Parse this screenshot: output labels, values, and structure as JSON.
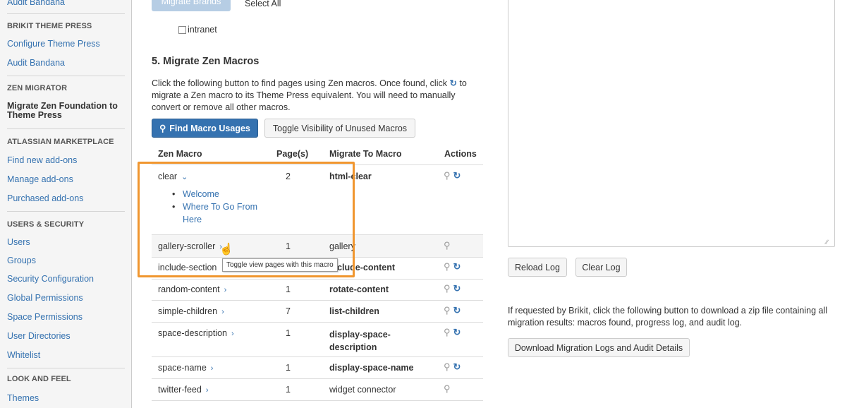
{
  "sidebar": {
    "items_top": [
      "Audit Bandana"
    ],
    "sections": [
      {
        "heading": "BRIKIT THEME PRESS",
        "items": [
          "Configure Theme Press",
          "Audit Bandana"
        ]
      },
      {
        "heading": "ZEN MIGRATOR",
        "active": "Migrate Zen Foundation to Theme Press"
      },
      {
        "heading": "ATLASSIAN MARKETPLACE",
        "items": [
          "Find new add-ons",
          "Manage add-ons",
          "Purchased add-ons"
        ]
      },
      {
        "heading": "USERS & SECURITY",
        "items": [
          "Users",
          "Groups",
          "Security Configuration",
          "Global Permissions",
          "Space Permissions",
          "User Directories",
          "Whitelist"
        ]
      },
      {
        "heading": "LOOK AND FEEL",
        "items": [
          "Themes"
        ]
      }
    ]
  },
  "brands": {
    "migrate_button": "Migrate Brands",
    "select_all": "Select All",
    "checkbox_label": "intranet"
  },
  "zen": {
    "title": "5. Migrate Zen Macros",
    "description_1": "Click the following button to find pages using Zen macros. Once found, click",
    "description_2": "to migrate a Zen macro to its Theme Press equivalent. You will need to manually convert or remove all other macros.",
    "find_button": "Find Macro Usages",
    "toggle_button": "Toggle Visibility of Unused Macros",
    "columns": [
      "Zen Macro",
      "Page(s)",
      "Migrate To Macro",
      "Actions"
    ],
    "rows": [
      {
        "macro": "clear",
        "pages": "2",
        "target": "html-clear",
        "target_bold": true,
        "refresh": true
      },
      {
        "macro": "gallery-scroller",
        "pages": "1",
        "target": "gallery",
        "target_bold": false,
        "refresh": false
      },
      {
        "macro": "include-section",
        "pages": "",
        "target": "include-content",
        "target_bold": true,
        "refresh": true
      },
      {
        "macro": "random-content",
        "pages": "1",
        "target": "rotate-content",
        "target_bold": true,
        "refresh": true
      },
      {
        "macro": "simple-children",
        "pages": "7",
        "target": "list-children",
        "target_bold": true,
        "refresh": true
      },
      {
        "macro": "space-description",
        "pages": "1",
        "target": "display-space-description",
        "target_bold": true,
        "refresh": true
      },
      {
        "macro": "space-name",
        "pages": "1",
        "target": "display-space-name",
        "target_bold": true,
        "refresh": true
      },
      {
        "macro": "twitter-feed",
        "pages": "1",
        "target": "widget connector",
        "target_bold": false,
        "refresh": false
      }
    ],
    "clear_pages": [
      "Welcome",
      "Where To Go From Here"
    ],
    "tooltip": "Toggle view pages with this macro"
  },
  "right": {
    "reload_button": "Reload Log",
    "clear_button": "Clear Log",
    "download_text": "If requested by Brikit, click the following button to download a zip file containing all migration results: macros found, progress log, and audit log.",
    "download_button": "Download Migration Logs and Audit Details"
  },
  "colors": {
    "link": "#3572b0",
    "primary": "#3572b0",
    "highlight": "#f0962f"
  }
}
